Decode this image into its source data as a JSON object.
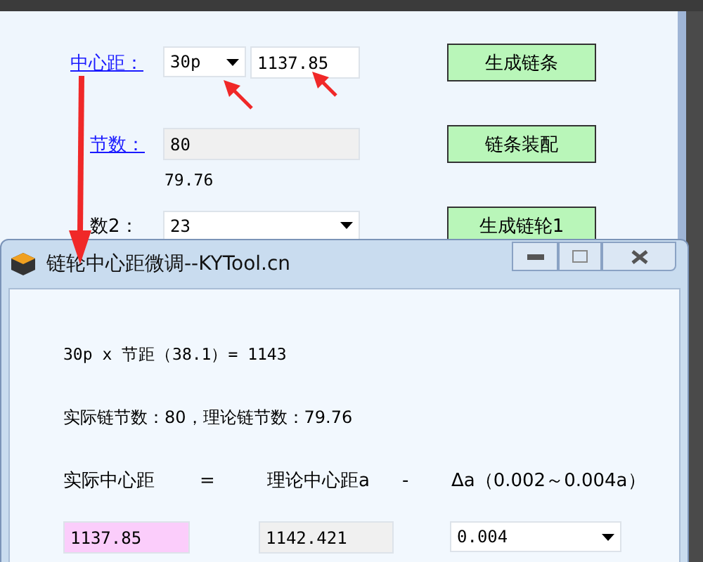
{
  "main_form": {
    "center_distance": {
      "label": "中心距：",
      "pitch": "30p",
      "value": "1137.85"
    },
    "chain_links": {
      "label": "节数：",
      "value": "80",
      "theoretical": "79.76"
    },
    "teeth2": {
      "label": "数2：",
      "value": "23"
    },
    "buttons": [
      "生成链条",
      "链条装配",
      "生成链轮1"
    ]
  },
  "dialog": {
    "title": "链轮中心距微调--KYTool.cn",
    "formula": "30p x 节距（38.1）= 1143",
    "links_info": "实际链节数：80，理论链节数：79.76",
    "headers": [
      "实际中心距",
      "=",
      "理论中心距a",
      "-",
      "Δa（0.002～0.004a）"
    ],
    "actual": "1137.85",
    "theoretical": "1142.421",
    "delta": "0.004"
  }
}
